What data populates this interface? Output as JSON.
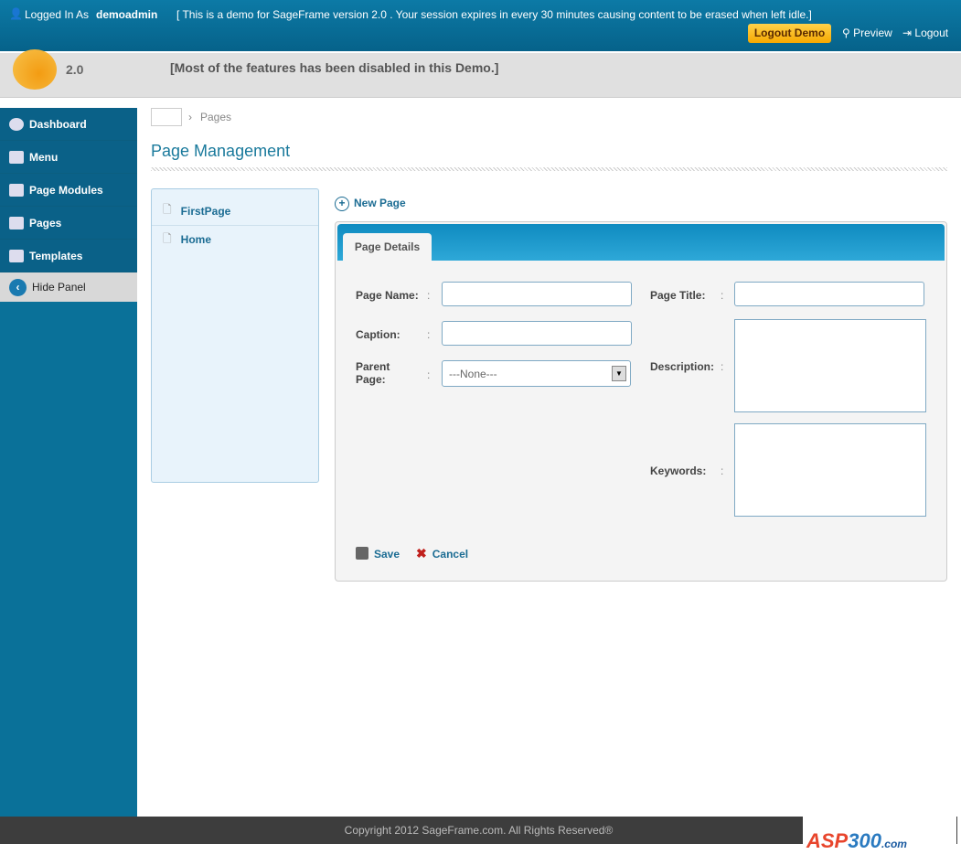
{
  "topbar": {
    "logged_in_label": "Logged In As",
    "username": "demoadmin",
    "notice": "[ This is a demo for SageFrame version 2.0 . Your session expires in every 30 minutes causing content to be erased when left idle.]",
    "logout_demo": "Logout Demo",
    "preview": "Preview",
    "logout": "Logout"
  },
  "header": {
    "version": "2.0",
    "notice": "[Most of the features has been disabled in this Demo.]"
  },
  "sidebar": {
    "items": [
      {
        "label": "Dashboard"
      },
      {
        "label": "Menu"
      },
      {
        "label": "Page Modules"
      },
      {
        "label": "Pages"
      },
      {
        "label": "Templates"
      }
    ],
    "hide_panel": "Hide Panel"
  },
  "breadcrumb": {
    "current": "Pages"
  },
  "page_title": "Page Management",
  "page_tree": [
    {
      "label": "FirstPage"
    },
    {
      "label": "Home"
    }
  ],
  "new_page": "New Page",
  "form": {
    "tab": "Page Details",
    "page_name": "Page Name:",
    "caption": "Caption:",
    "parent_page": "Parent Page:",
    "parent_value": "---None---",
    "page_title": "Page Title:",
    "description": "Description:",
    "keywords": "Keywords:",
    "colon": ":",
    "save": "Save",
    "cancel": "Cancel"
  },
  "footer": "Copyright 2012 SageFrame.com. All Rights Reserved®",
  "watermark": "ASP300源码.com"
}
